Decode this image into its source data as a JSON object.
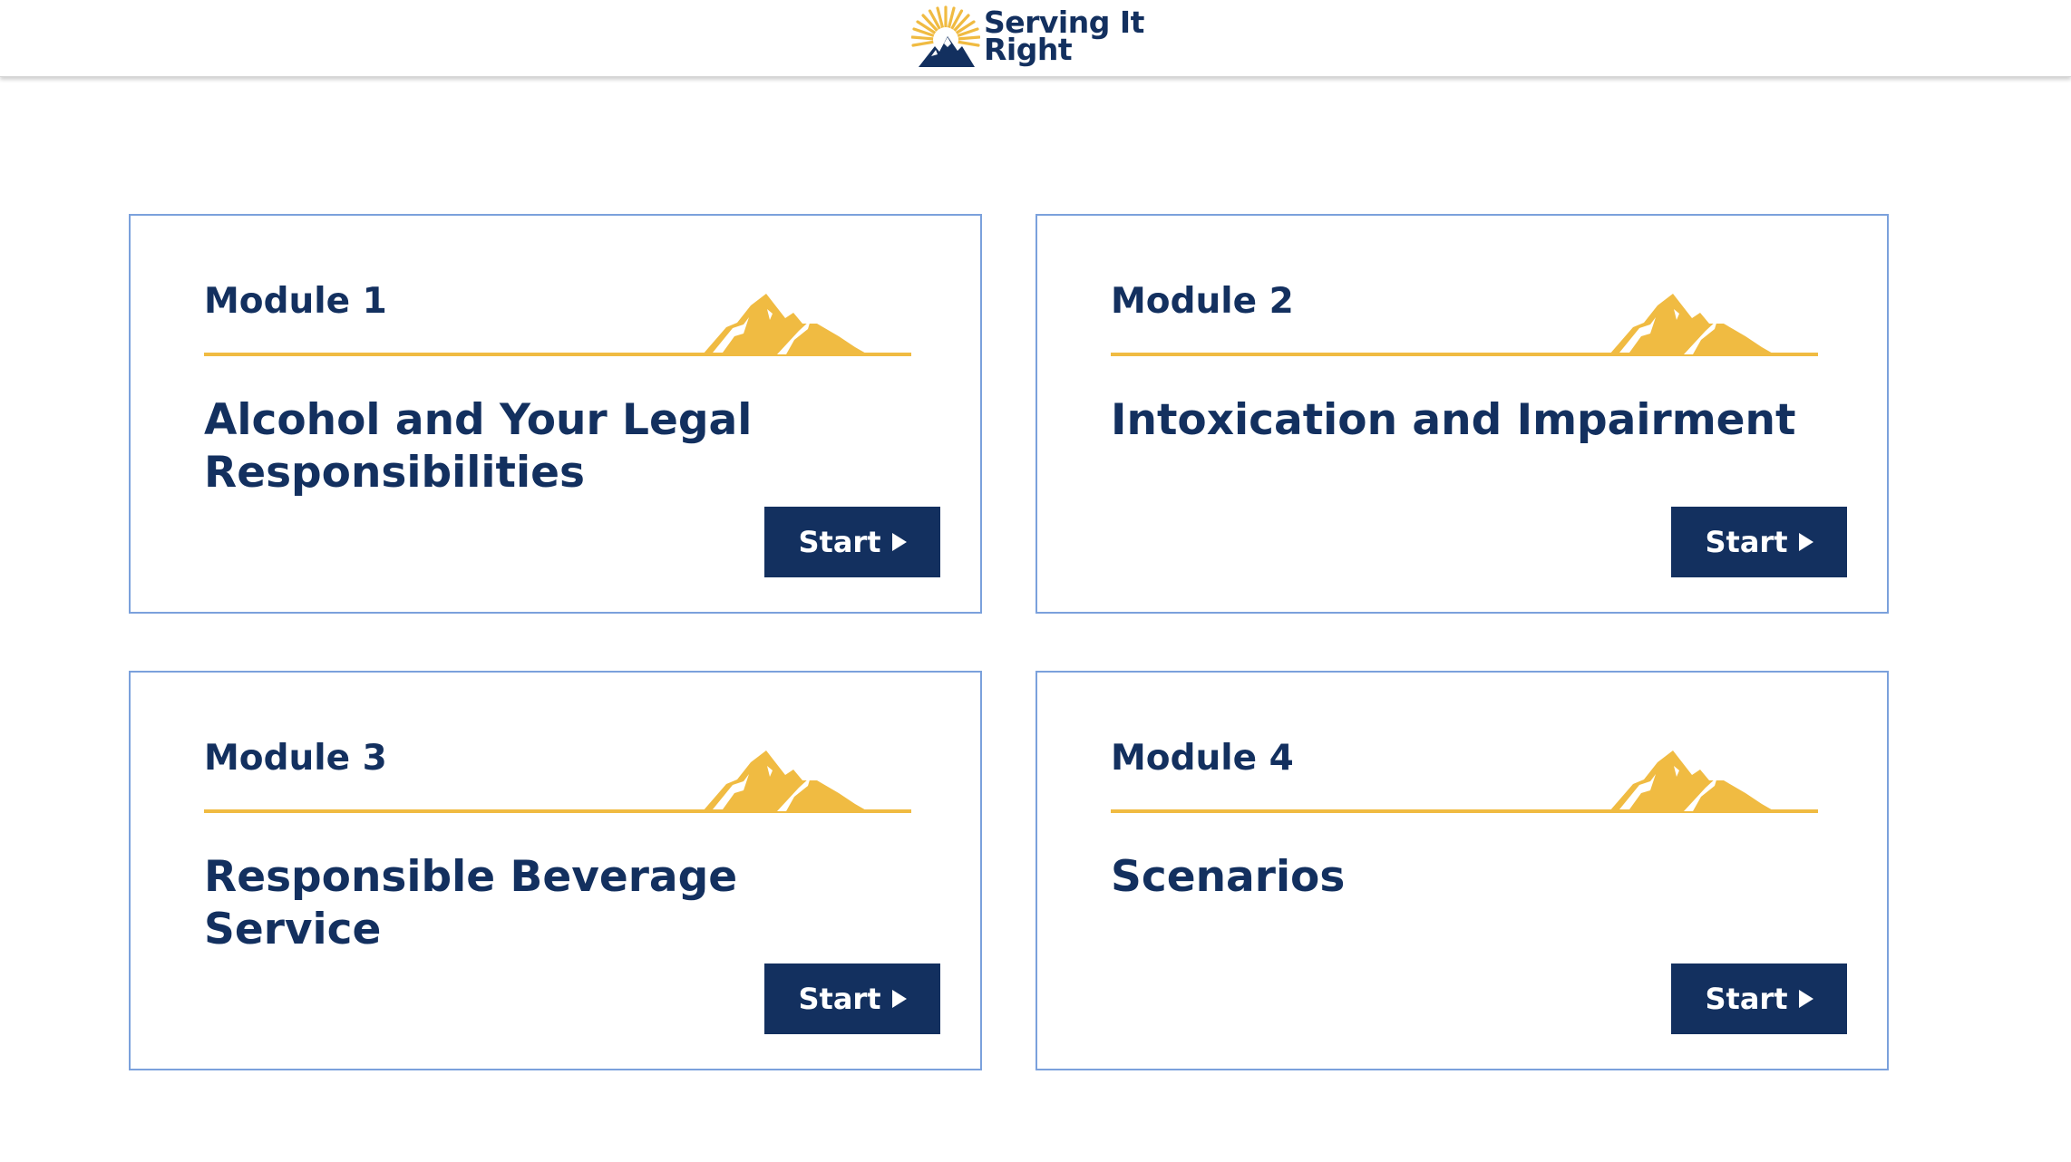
{
  "header": {
    "logo_line1": "Serving It",
    "logo_line2": "Right",
    "logo_icon": "sunburst-mountain-icon"
  },
  "colors": {
    "navy": "#13305f",
    "gold": "#f0bb42",
    "card_border": "#7ba1dc"
  },
  "modules": [
    {
      "label": "Module 1",
      "title": "Alcohol and Your Legal Responsibilities",
      "button": "Start"
    },
    {
      "label": "Module 2",
      "title": "Intoxication and Impairment",
      "button": "Start"
    },
    {
      "label": "Module 3",
      "title": "Responsible Beverage Service",
      "button": "Start"
    },
    {
      "label": "Module 4",
      "title": "Scenarios",
      "button": "Start"
    }
  ]
}
